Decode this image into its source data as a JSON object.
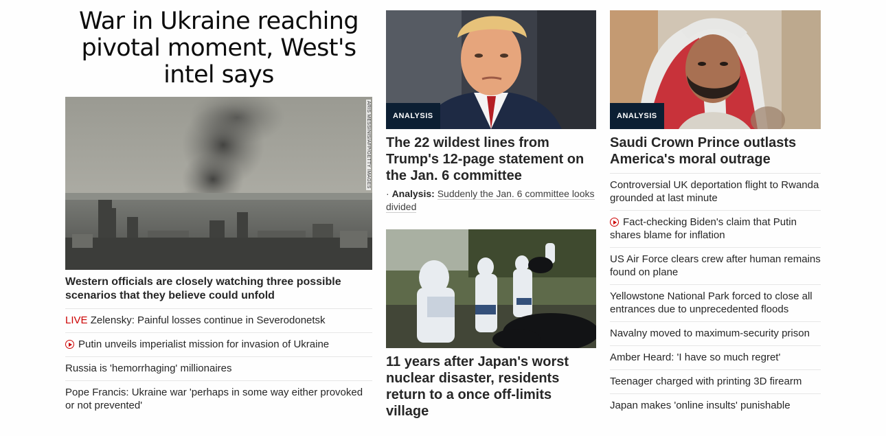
{
  "lead": {
    "headline": "War in Ukraine reaching pivotal moment, West's intel says",
    "image_alt": "Smoke rising over an industrial city skyline",
    "image_credit": "ARIS MESSINIS/AFP/GETTY IMAGES",
    "subheadline": "Western officials are closely watching three possible scenarios that they believe could unfold",
    "items": [
      {
        "prefix": "LIVE",
        "text": "Zelensky: Painful losses continue in Severodonetsk",
        "icon": "none"
      },
      {
        "prefix": "",
        "text": "Putin unveils imperialist mission for invasion of Ukraine",
        "icon": "play-video-icon"
      },
      {
        "prefix": "",
        "text": "Russia is 'hemorrhaging' millionaires",
        "icon": "none"
      },
      {
        "prefix": "",
        "text": "Pope Francis: Ukraine war 'perhaps in some way either provoked or not prevented'",
        "icon": "none"
      }
    ]
  },
  "trump_card": {
    "badge": "ANALYSIS",
    "title": "The 22 wildest lines from Trump's 12-page statement on the Jan. 6 committee",
    "sub_label": "Analysis:",
    "sub_text": "Suddenly the Jan. 6 committee looks divided"
  },
  "japan_card": {
    "title": "11 years after Japan's worst nuclear disaster, residents return to a once off-limits village"
  },
  "saudi_card": {
    "badge": "ANALYSIS",
    "title": "Saudi Crown Prince outlasts America's moral outrage",
    "items": [
      {
        "text": "Controversial UK deportation flight to Rwanda grounded at last minute",
        "icon": "none"
      },
      {
        "text": "Fact-checking Biden's claim that Putin shares blame for inflation",
        "icon": "play-video-icon"
      },
      {
        "text": "US Air Force clears crew after human remains found on plane",
        "icon": "none"
      },
      {
        "text": "Yellowstone National Park forced to close all entrances due to unprecedented floods",
        "icon": "none"
      },
      {
        "text": "Navalny moved to maximum-security prison",
        "icon": "none"
      },
      {
        "text": "Amber Heard: 'I have so much regret'",
        "icon": "none"
      },
      {
        "text": "Teenager charged with printing 3D firearm",
        "icon": "none"
      },
      {
        "text": "Japan makes 'online insults' punishable",
        "icon": "none"
      }
    ]
  },
  "colors": {
    "live": "#cc0000",
    "badge_bg": "#0c1f33",
    "divider": "#e6e6e6"
  }
}
